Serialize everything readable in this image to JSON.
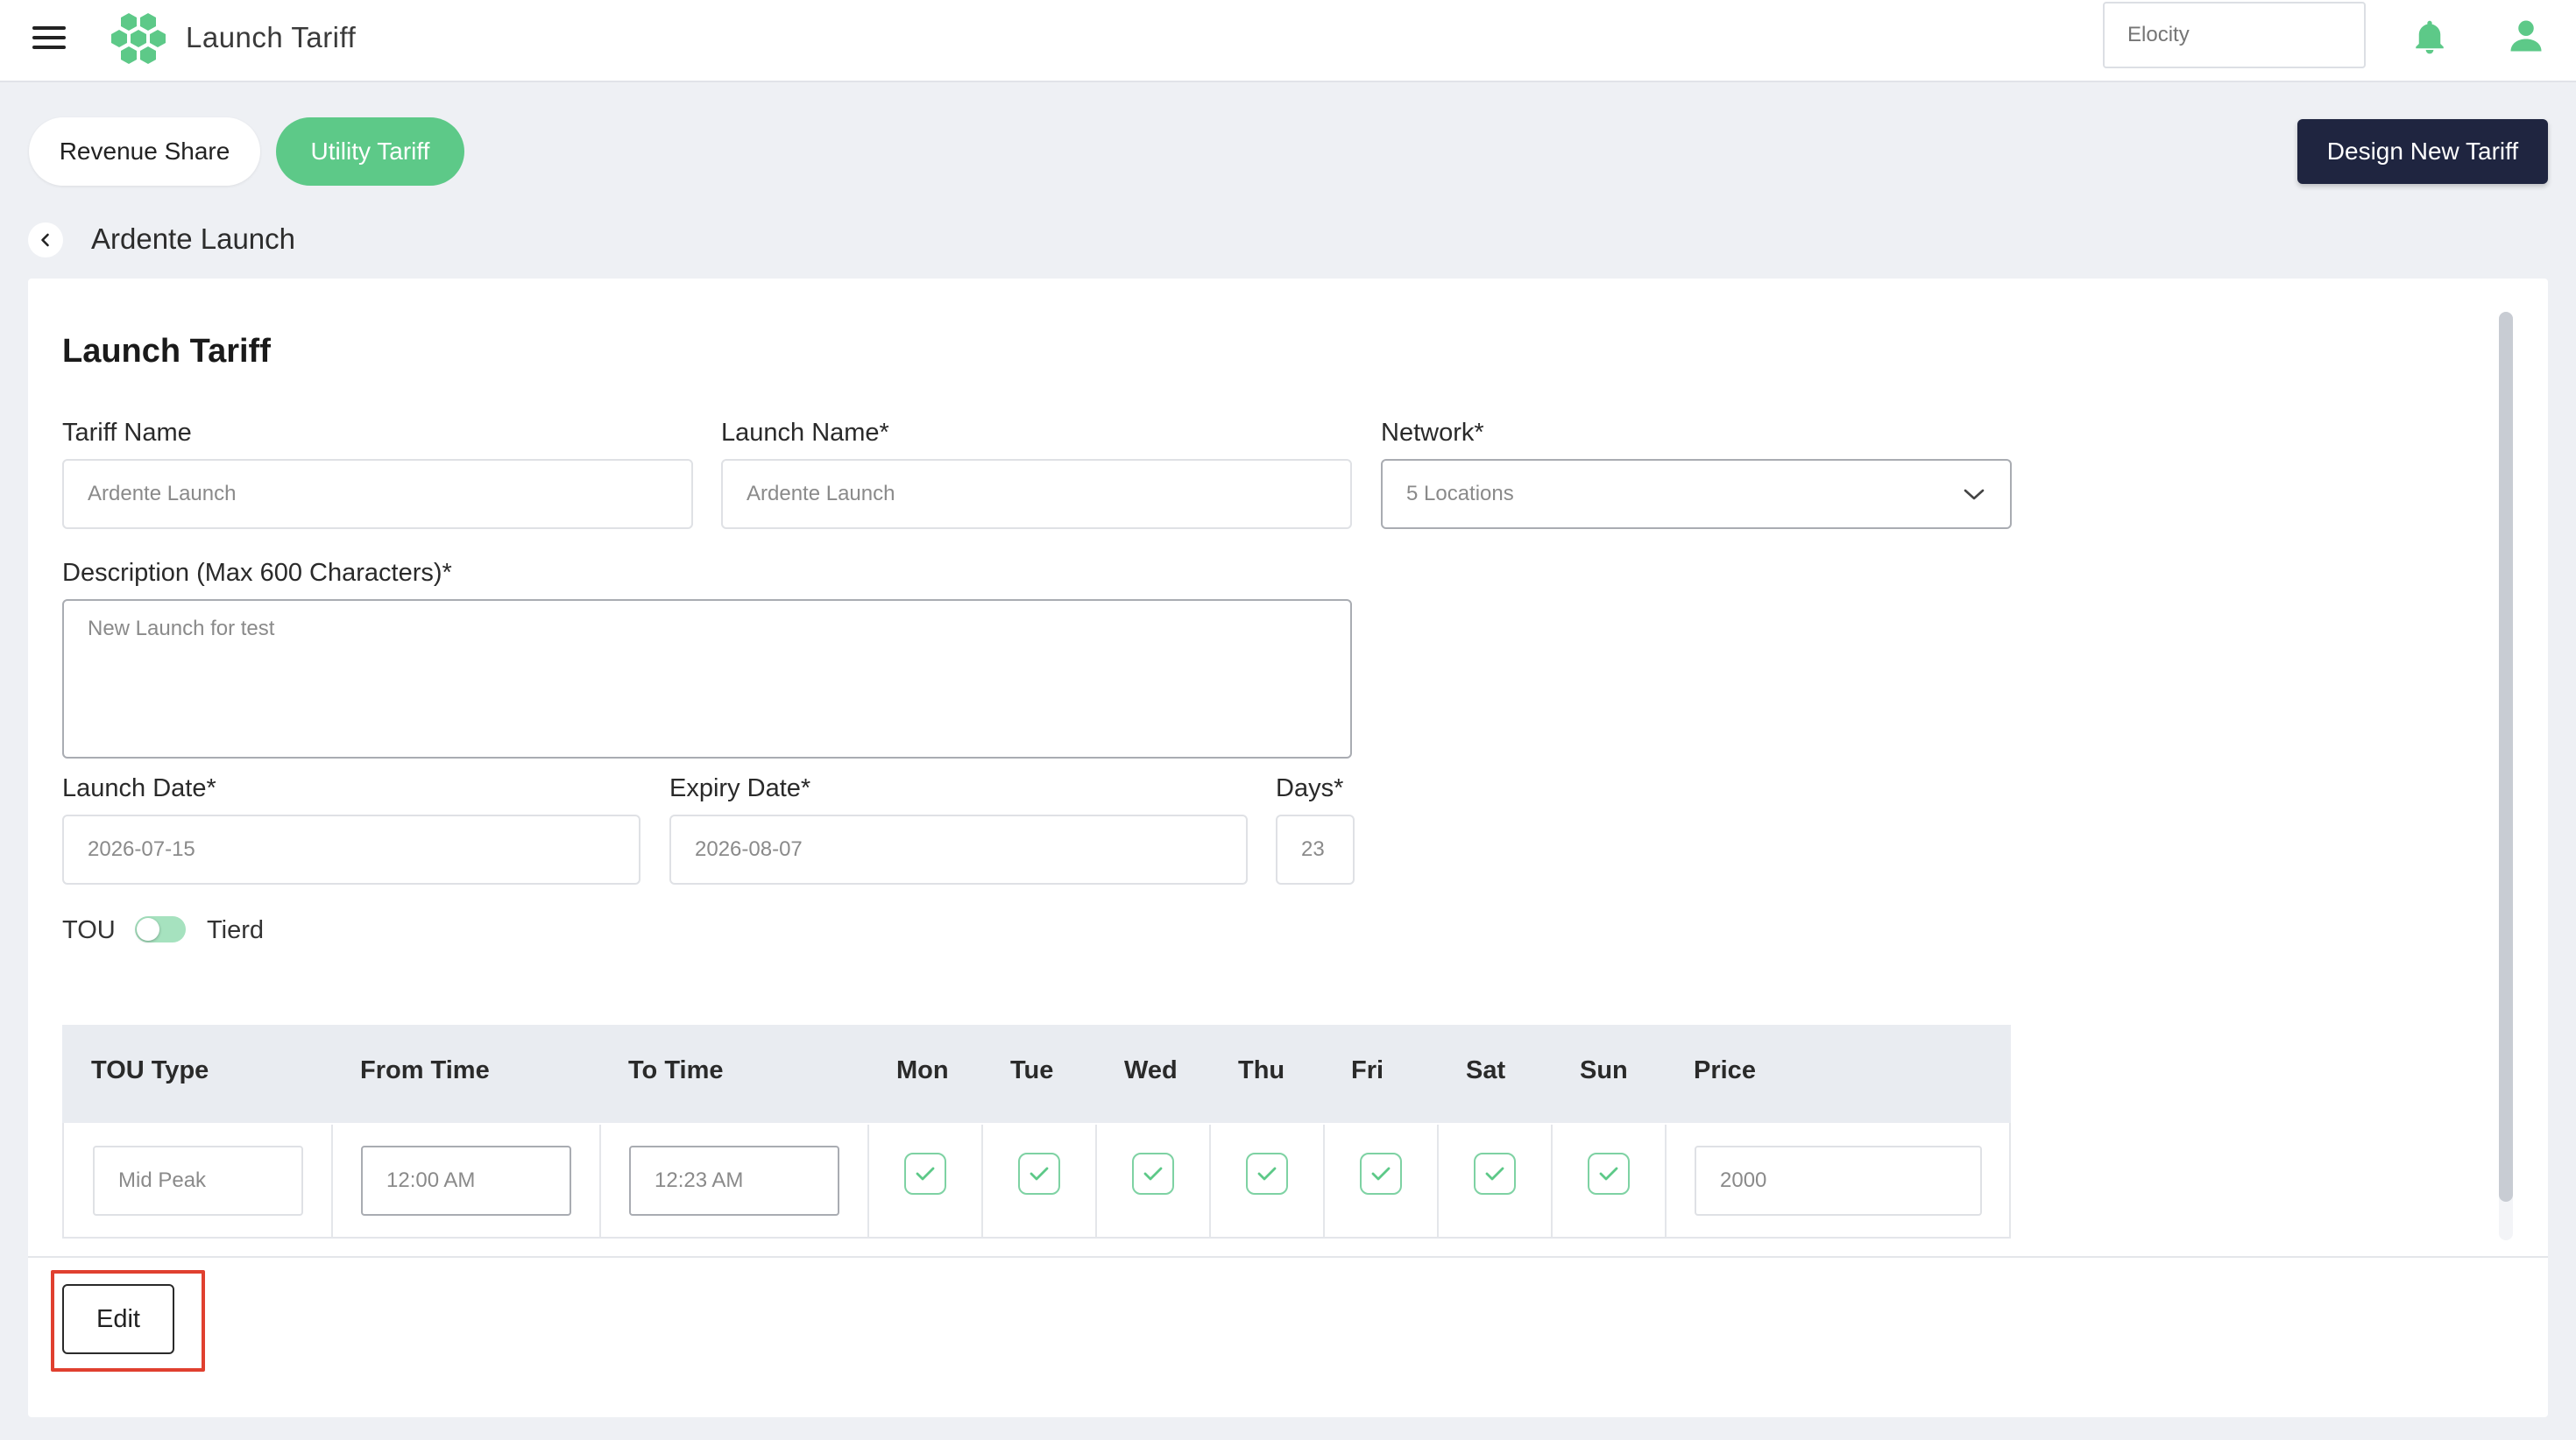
{
  "header": {
    "app_title": "Launch Tariff",
    "org_placeholder": "Elocity",
    "icons": [
      "menu-icon",
      "logo-icon",
      "bell-icon",
      "user-icon"
    ]
  },
  "tabs": [
    {
      "label": "Revenue Share",
      "active": false
    },
    {
      "label": "Utility Tariff",
      "active": true
    }
  ],
  "design_button_label": "Design New Tariff",
  "breadcrumb": {
    "title": "Ardente Launch"
  },
  "form": {
    "card_title": "Launch Tariff",
    "tariff_name": {
      "label": "Tariff Name",
      "value": "Ardente Launch"
    },
    "launch_name": {
      "label": "Launch Name*",
      "value": "Ardente Launch"
    },
    "network": {
      "label": "Network*",
      "value": "5 Locations"
    },
    "description": {
      "label": "Description (Max 600 Characters)*",
      "value": "New Launch for test"
    },
    "launch_date": {
      "label": "Launch Date*",
      "value": "2026-07-15"
    },
    "expiry_date": {
      "label": "Expiry Date*",
      "value": "2026-08-07"
    },
    "days": {
      "label": "Days*",
      "value": "23"
    },
    "toggle": {
      "left_label": "TOU",
      "right_label": "Tierd"
    }
  },
  "table": {
    "headers": [
      "TOU Type",
      "From Time",
      "To Time",
      "Mon",
      "Tue",
      "Wed",
      "Thu",
      "Fri",
      "Sat",
      "Sun",
      "Price"
    ],
    "rows": [
      {
        "tou_type": "Mid Peak",
        "from_time": "12:00 AM",
        "to_time": "12:23 AM",
        "days_checked": [
          true,
          true,
          true,
          true,
          true,
          true,
          true
        ],
        "price": "2000"
      }
    ]
  },
  "footer": {
    "edit_label": "Edit"
  },
  "colors": {
    "accent_green": "#5dc988",
    "dark_navy": "#1f2540",
    "highlight_red": "#e0402f",
    "background": "#eef0f4"
  }
}
